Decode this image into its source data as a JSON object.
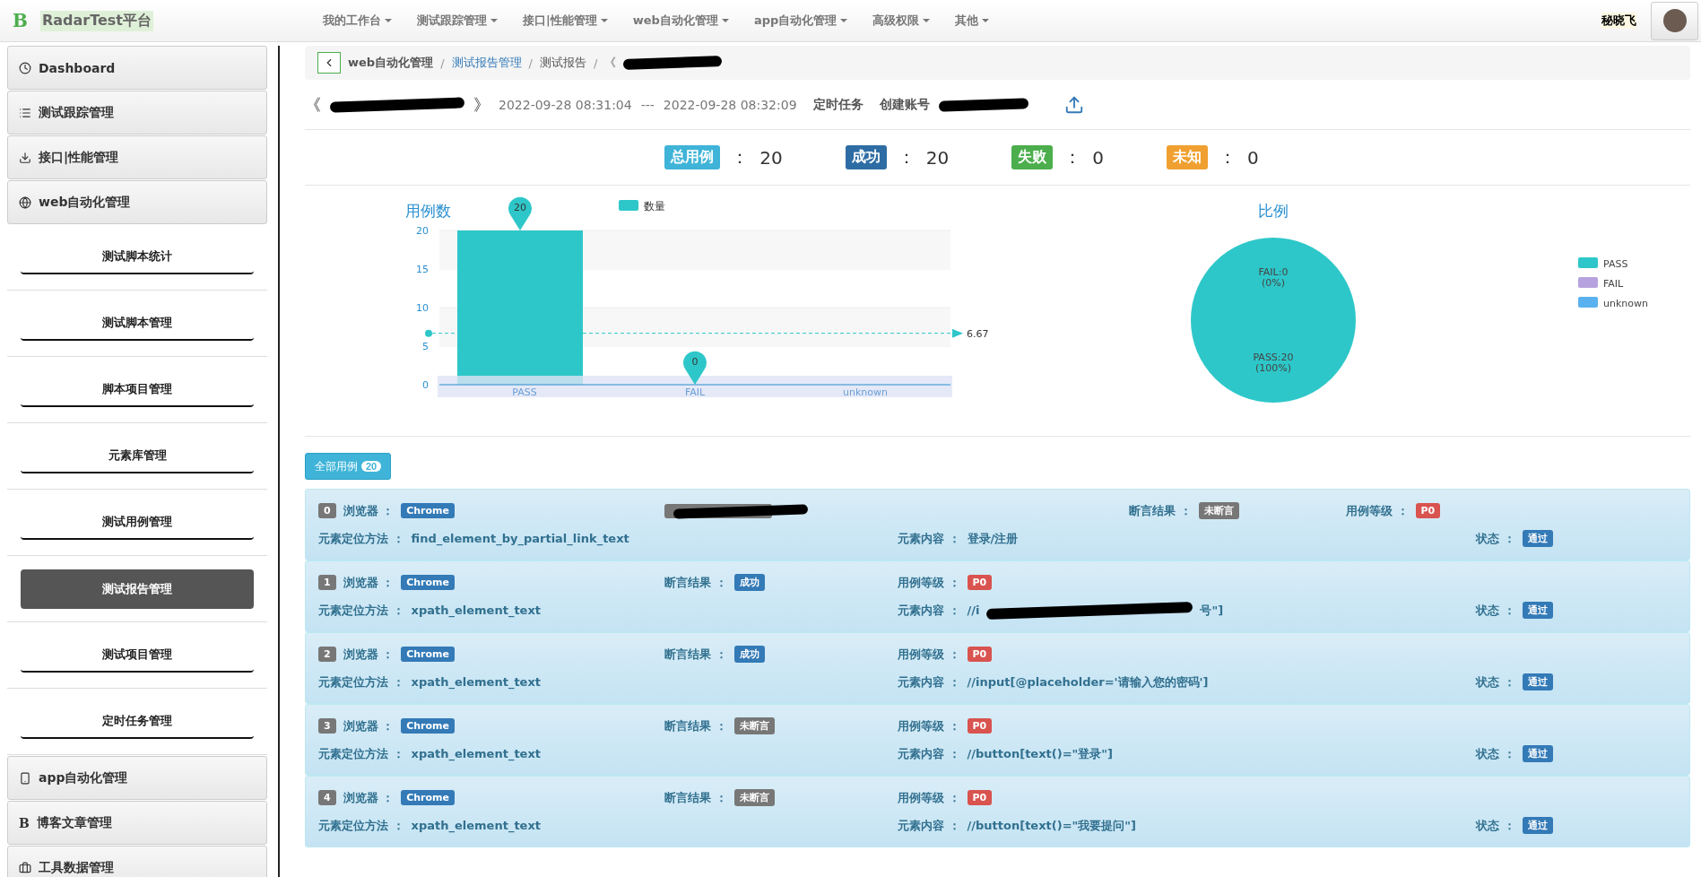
{
  "brand": {
    "logo": "B",
    "name": "RadarTest平台"
  },
  "nav": [
    {
      "label": "我的工作台"
    },
    {
      "label": "测试跟踪管理"
    },
    {
      "label": "接口|性能管理"
    },
    {
      "label": "web自动化管理"
    },
    {
      "label": "app自动化管理"
    },
    {
      "label": "高级权限"
    },
    {
      "label": "其他"
    }
  ],
  "user": {
    "name": "秘晓飞"
  },
  "sidebar": {
    "items": [
      {
        "label": "Dashboard"
      },
      {
        "label": "测试跟踪管理"
      },
      {
        "label": "接口|性能管理"
      },
      {
        "label": "web自动化管理",
        "children": [
          {
            "label": "测试脚本统计",
            "selected": false
          },
          {
            "label": "测试脚本管理",
            "selected": false
          },
          {
            "label": "脚本项目管理",
            "selected": false
          },
          {
            "label": "元素库管理",
            "selected": false
          },
          {
            "label": "测试用例管理",
            "selected": false
          },
          {
            "label": "测试报告管理",
            "selected": true
          },
          {
            "label": "测试项目管理",
            "selected": false
          },
          {
            "label": "定时任务管理",
            "selected": false
          }
        ]
      },
      {
        "label": "app自动化管理"
      },
      {
        "label": "博客文章管理",
        "icon_text": "B"
      },
      {
        "label": "工具数据管理"
      }
    ]
  },
  "breadcrumb": [
    {
      "label": "web自动化管理",
      "link": false
    },
    {
      "separator": "/",
      "label": "测试报告管理",
      "link": true
    },
    {
      "separator": "/",
      "label": "测试报告",
      "link": false
    },
    {
      "separator": "/",
      "label": "《",
      "link": false
    }
  ],
  "report": {
    "title_start": "《",
    "title_end": "》",
    "start": "2022-09-28 08:31:04",
    "separator": "---",
    "end": "2022-09-28 08:32:09",
    "trigger": "定时任务",
    "account_label": "创建账号"
  },
  "summary": [
    {
      "label": "总用例",
      "colon": "：",
      "value": "20",
      "color": "#3fb4d8"
    },
    {
      "label": "成功",
      "colon": "：",
      "value": "20",
      "color": "#2e6da4"
    },
    {
      "label": "失败",
      "colon": "：",
      "value": "0",
      "color": "#4cae4c"
    },
    {
      "label": "未知",
      "colon": "：",
      "value": "0",
      "color": "#f0a030"
    }
  ],
  "bar_chart": {
    "chart_data": {
      "type": "bar",
      "title": "用例数",
      "categories": [
        "PASS",
        "FAIL",
        "unknown"
      ],
      "series": [
        {
          "name": "数量",
          "color": "#2ec7c9",
          "values": [
            20,
            0,
            0
          ]
        }
      ],
      "ylim": [
        0,
        20
      ],
      "yticks": [
        0,
        5,
        10,
        15,
        20
      ],
      "grid": true,
      "annotations": [
        {
          "x": "PASS",
          "y": 20,
          "text": "20"
        },
        {
          "x": "FAIL",
          "y": 0,
          "text": "0"
        }
      ],
      "ref_lines": [
        {
          "axis": "y",
          "value": 6.67,
          "label": "6.67"
        }
      ]
    }
  },
  "pie_chart": {
    "chart_data": {
      "type": "pie",
      "title": "比例",
      "categories": [
        "PASS",
        "FAIL",
        "unknown"
      ],
      "series": [
        {
          "values": [
            100,
            0,
            0
          ]
        }
      ],
      "colors": [
        "#2ec7c9",
        "#b6a2de",
        "#5ab1ef"
      ]
    },
    "slice_labels": [
      {
        "name": "FAIL:0",
        "share": "(0%)"
      },
      {
        "name": "PASS:20",
        "share": "(100%)"
      }
    ]
  },
  "filter_button": {
    "label": "全部用例",
    "count": "20"
  },
  "cases": [
    {
      "index": "0",
      "browser_label": "浏览器 ：",
      "browser": "Chrome",
      "extra_redacted": true,
      "assert_label": "断言结果 ：",
      "assert": {
        "text": "未断言",
        "color": "#777777"
      },
      "level_label": "用例等级 ：",
      "level": "P0",
      "method_label": "元素定位方法 ：",
      "method": "find_element_by_partial_link_text",
      "content_label": "元素内容 ：",
      "content": "登录/注册",
      "status_label": "状态 ：",
      "status": "通过"
    },
    {
      "index": "1",
      "browser_label": "浏览器 ：",
      "browser": "Chrome",
      "assert_label": "断言结果 ：",
      "assert": {
        "text": "成功",
        "color": "#337ab7"
      },
      "level_label": "用例等级 ：",
      "level": "P0",
      "method_label": "元素定位方法 ：",
      "method": "xpath_element_text",
      "content_label": "元素内容 ：",
      "content": "//i",
      "content_tail": "号\"]",
      "content_redacted": true,
      "status_label": "状态 ：",
      "status": "通过"
    },
    {
      "index": "2",
      "browser_label": "浏览器 ：",
      "browser": "Chrome",
      "assert_label": "断言结果 ：",
      "assert": {
        "text": "成功",
        "color": "#337ab7"
      },
      "level_label": "用例等级 ：",
      "level": "P0",
      "method_label": "元素定位方法 ：",
      "method": "xpath_element_text",
      "content_label": "元素内容 ：",
      "content": "//input[@placeholder='请输入您的密码']",
      "status_label": "状态 ：",
      "status": "通过"
    },
    {
      "index": "3",
      "browser_label": "浏览器 ：",
      "browser": "Chrome",
      "assert_label": "断言结果 ：",
      "assert": {
        "text": "未断言",
        "color": "#777777"
      },
      "level_label": "用例等级 ：",
      "level": "P0",
      "method_label": "元素定位方法 ：",
      "method": "xpath_element_text",
      "content_label": "元素内容 ：",
      "content": "//button[text()=\"登录\"]",
      "status_label": "状态 ：",
      "status": "通过"
    },
    {
      "index": "4",
      "browser_label": "浏览器 ：",
      "browser": "Chrome",
      "assert_label": "断言结果 ：",
      "assert": {
        "text": "未断言",
        "color": "#777777"
      },
      "level_label": "用例等级 ：",
      "level": "P0",
      "method_label": "元素定位方法 ：",
      "method": "xpath_element_text",
      "content_label": "元素内容 ：",
      "content": "//button[text()=\"我要提问\"]",
      "status_label": "状态 ：",
      "status": "通过"
    }
  ]
}
